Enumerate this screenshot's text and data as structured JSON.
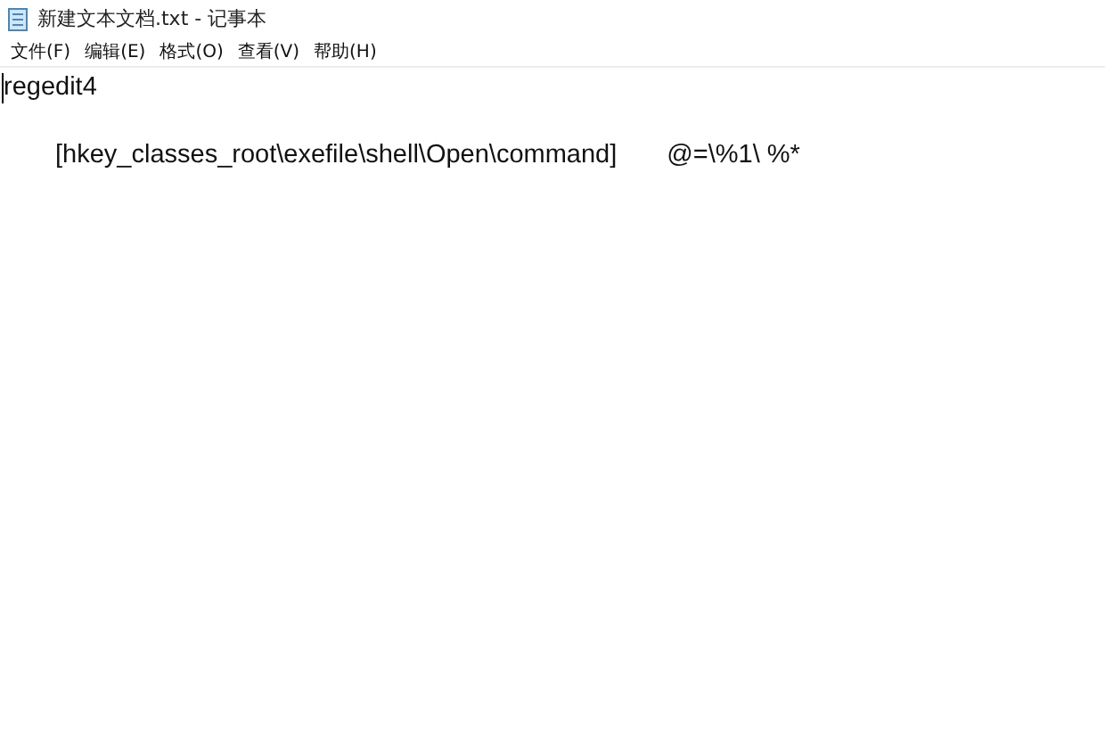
{
  "window": {
    "title": "新建文本文档.txt - 记事本"
  },
  "menu": [
    "文件(F)",
    "编辑(E)",
    "格式(O)",
    "查看(V)",
    "帮助(H)"
  ],
  "editor": {
    "lines": [
      {
        "kind": "plain",
        "text": "regedit4"
      },
      {
        "kind": "blank"
      },
      {
        "kind": "indented",
        "parts": [
          "[hkey_classes_root\\exefile\\shell\\Open\\command]",
          "@=\\%1\\ %*"
        ]
      }
    ]
  }
}
